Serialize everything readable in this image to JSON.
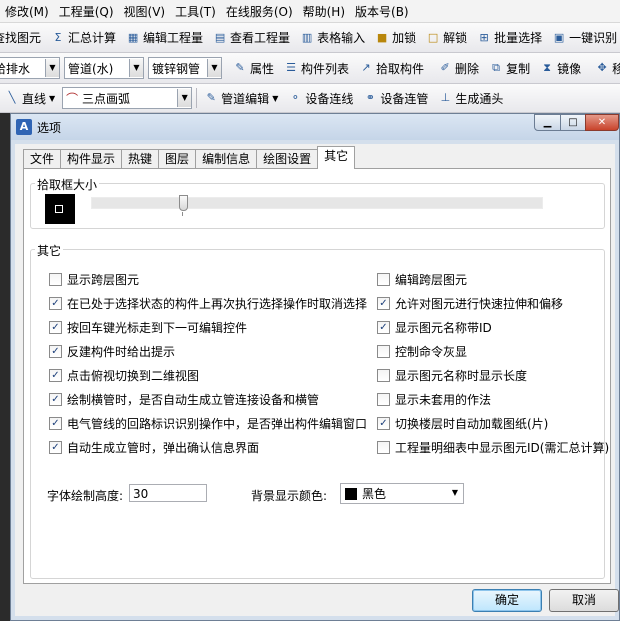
{
  "menubar": [
    "修改(M)",
    "工程量(Q)",
    "视图(V)",
    "工具(T)",
    "在线服务(O)",
    "帮助(H)",
    "版本号(B)"
  ],
  "toolbar1": {
    "find": "查找图元",
    "sum": "汇总计算",
    "edit_project": "编辑工程量",
    "view_project": "查看工程量",
    "table_input": "表格输入",
    "lock": "加锁",
    "unlock": "解锁",
    "batch_select": "批量选择",
    "one_key": "一键识别"
  },
  "toolbar2": {
    "combo1": "给排水",
    "combo2": "管道(水)",
    "combo3": "镀锌钢管",
    "properties": "属性",
    "component_list": "构件列表",
    "pick": "拾取构件",
    "delete": "删除",
    "copy": "复制",
    "mirror": "镜像",
    "move": "移"
  },
  "toolbar3": {
    "line": "直线",
    "arc_combo": "三点画弧",
    "pipe_edit": "管道编辑",
    "device_conn": "设备连线",
    "device_pipe": "设备连管",
    "gen_fitting": "生成通头"
  },
  "dialog": {
    "title": "选项",
    "tabs": [
      "文件",
      "构件显示",
      "热键",
      "图层",
      "编制信息",
      "绘图设置",
      "其它"
    ],
    "active_tab": 6,
    "pick_box": {
      "title": "拾取框大小",
      "level": 0.2
    },
    "other": {
      "title": "其它",
      "left": [
        {
          "label": "显示跨层图元",
          "checked": false
        },
        {
          "label": "在已处于选择状态的构件上再次执行选择操作时取消选择",
          "checked": true
        },
        {
          "label": "按回车键光标走到下一可编辑控件",
          "checked": true
        },
        {
          "label": "反建构件时给出提示",
          "checked": true
        },
        {
          "label": "点击俯视切换到二维视图",
          "checked": true
        },
        {
          "label": "绘制横管时，是否自动生成立管连接设备和横管",
          "checked": true
        },
        {
          "label": "电气管线的回路标识识别操作中，是否弹出构件编辑窗口",
          "checked": true
        },
        {
          "label": "自动生成立管时，弹出确认信息界面",
          "checked": true
        }
      ],
      "right": [
        {
          "label": "编辑跨层图元",
          "checked": false
        },
        {
          "label": "允许对图元进行快速拉伸和偏移",
          "checked": true
        },
        {
          "label": "显示图元名称带ID",
          "checked": true
        },
        {
          "label": "控制命令灰显",
          "checked": false
        },
        {
          "label": "显示图元名称时显示长度",
          "checked": false
        },
        {
          "label": "显示未套用的作法",
          "checked": false
        },
        {
          "label": "切换楼层时自动加载图纸(片)",
          "checked": true
        },
        {
          "label": "工程量明细表中显示图元ID(需汇总计算)",
          "checked": false
        }
      ],
      "font_height_label": "字体绘制高度:",
      "font_height_value": "30",
      "bg_color_label": "背景显示颜色:",
      "bg_color_value": "黑色"
    },
    "ok": "确定",
    "cancel": "取消"
  },
  "colors": {
    "bg_swatch": "#000000",
    "title_bar": "#c5d5e8",
    "close_button": "#c8432b"
  }
}
